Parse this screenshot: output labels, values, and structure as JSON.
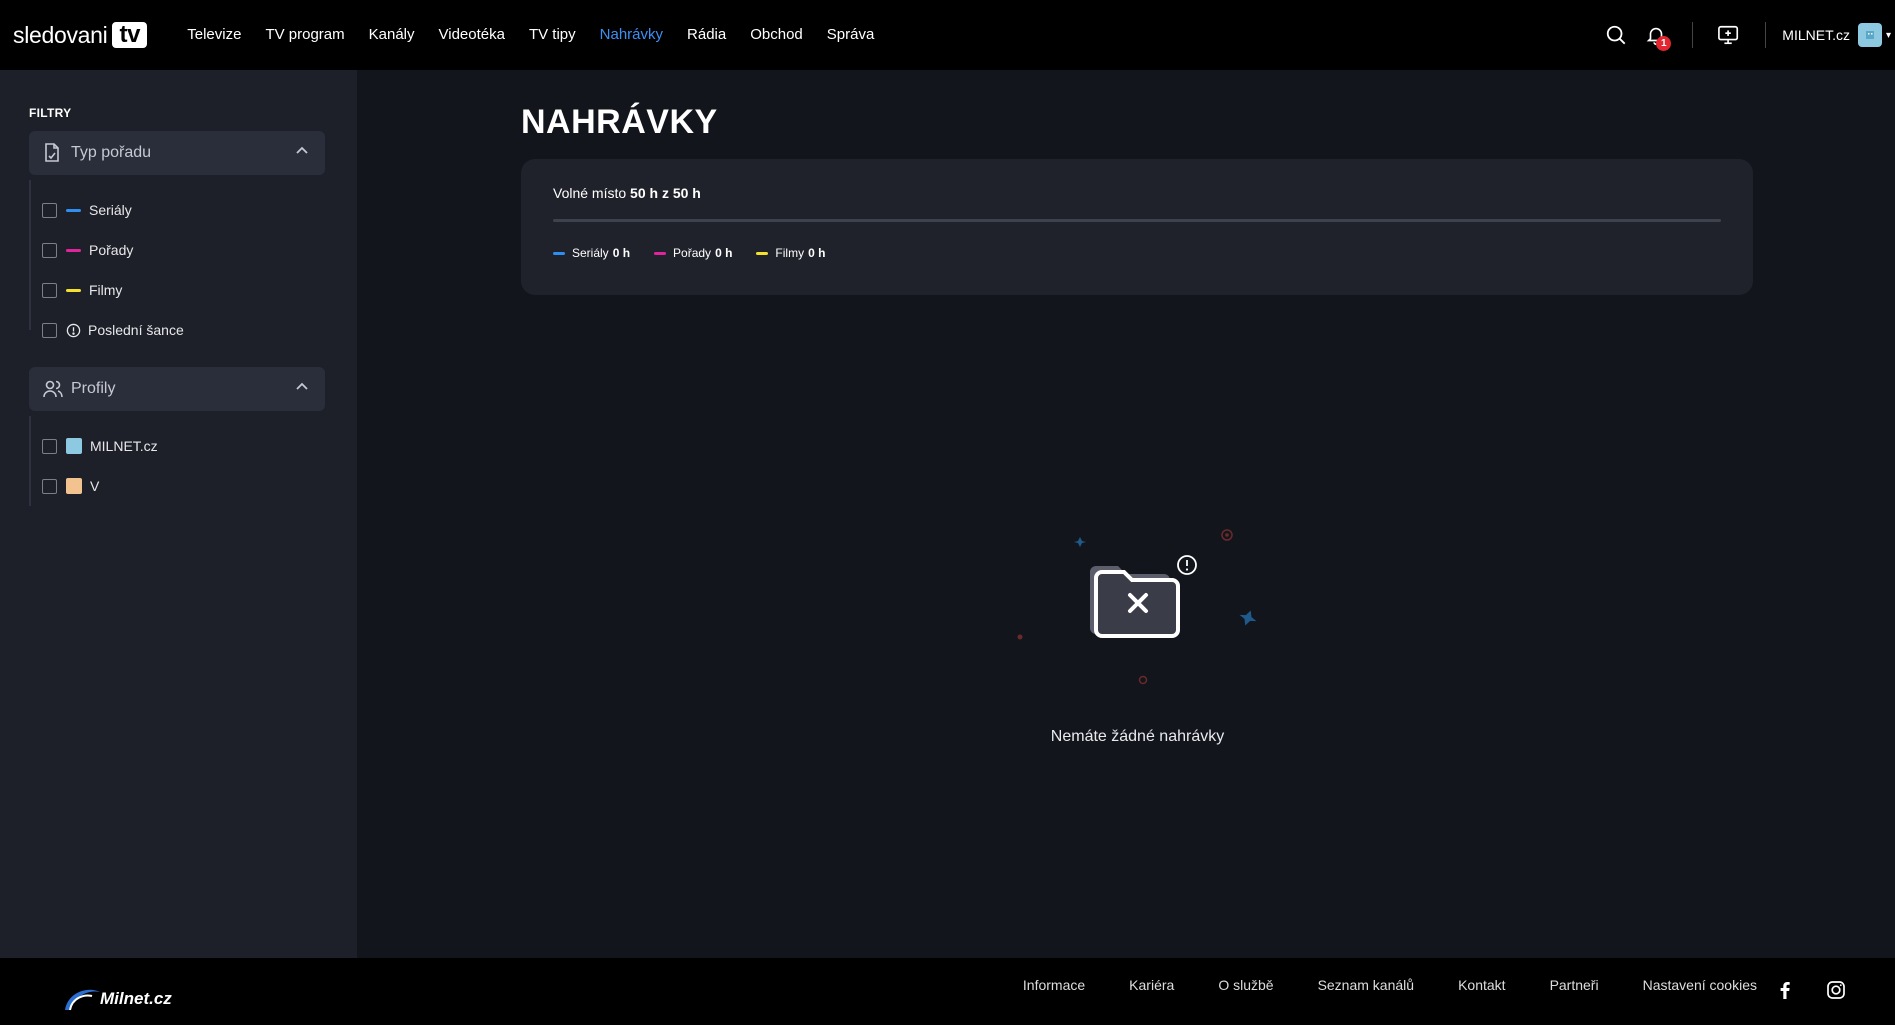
{
  "brand": {
    "name": "sledovani",
    "tv": "tv"
  },
  "nav": [
    {
      "label": "Televize",
      "active": false
    },
    {
      "label": "TV program",
      "active": false
    },
    {
      "label": "Kanály",
      "active": false
    },
    {
      "label": "Videotéka",
      "active": false
    },
    {
      "label": "TV tipy",
      "active": false
    },
    {
      "label": "Nahrávky",
      "active": true
    },
    {
      "label": "Rádia",
      "active": false
    },
    {
      "label": "Obchod",
      "active": false
    },
    {
      "label": "Správa",
      "active": false
    }
  ],
  "header": {
    "notification_count": "1",
    "account_name": "MILNET.cz",
    "icons": [
      "search-icon",
      "bell-icon",
      "add-device-icon",
      "avatar",
      "chevron-down-icon"
    ]
  },
  "sidebar": {
    "title": "FILTRY",
    "type_group": {
      "label": "Typ pořadu",
      "options": [
        {
          "label": "Seriály",
          "color": "#2f8ff0",
          "checked": false
        },
        {
          "label": "Pořady",
          "color": "#e0249b",
          "checked": false
        },
        {
          "label": "Filmy",
          "color": "#f5e02b",
          "checked": false
        },
        {
          "label": "Poslední šance",
          "icon": "alert-circle-icon",
          "checked": false
        }
      ]
    },
    "profiles_group": {
      "label": "Profily",
      "options": [
        {
          "label": "MILNET.cz",
          "avatar_color": "#8ec9e2",
          "checked": false
        },
        {
          "label": "V",
          "avatar_color": "#f3c38f",
          "checked": false
        }
      ]
    }
  },
  "main": {
    "title": "NAHRÁVKY",
    "storage": {
      "label": "Volné místo",
      "value": "50 h z 50 h",
      "used_fraction": 0,
      "legend": [
        {
          "label": "Seriály",
          "value": "0 h",
          "color": "#2f8ff0"
        },
        {
          "label": "Pořady",
          "value": "0 h",
          "color": "#e0249b"
        },
        {
          "label": "Filmy",
          "value": "0 h",
          "color": "#f5e02b"
        }
      ]
    },
    "empty_message": "Nemáte žádné nahrávky"
  },
  "footer": {
    "logo_text": "Milnet.cz",
    "links": [
      "Informace",
      "Kariéra",
      "O službě",
      "Seznam kanálů",
      "Kontakt",
      "Partneři",
      "Nastavení cookies"
    ],
    "social": [
      "facebook-icon",
      "instagram-icon"
    ]
  },
  "colors": {
    "accent": "#3d8ff3",
    "background": "#13151d",
    "sidebar": "#1d2029",
    "card": "#1f222b"
  }
}
